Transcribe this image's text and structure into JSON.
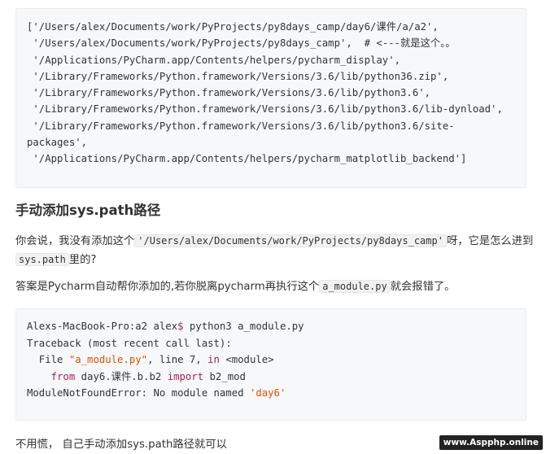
{
  "code_block_1": {
    "lines": [
      "['/Users/alex/Documents/work/PyProjects/py8days_camp/day6/课件/a/a2',",
      " '/Users/alex/Documents/work/PyProjects/py8days_camp',  # <---就是这个。。",
      " '/Applications/PyCharm.app/Contents/helpers/pycharm_display',",
      " '/Library/Frameworks/Python.framework/Versions/3.6/lib/python36.zip',",
      " '/Library/Frameworks/Python.framework/Versions/3.6/lib/python3.6',",
      " '/Library/Frameworks/Python.framework/Versions/3.6/lib/python3.6/lib-dynload',",
      " '/Library/Frameworks/Python.framework/Versions/3.6/lib/python3.6/site-",
      "packages',",
      " '/Applications/PyCharm.app/Contents/helpers/pycharm_matplotlib_backend']"
    ]
  },
  "heading": "手动添加sys.path路径",
  "para1": {
    "t1": "你会说，我没有添加这个",
    "code1": "'/Users/alex/Documents/work/PyProjects/py8days_camp'",
    "t2": "呀，它是怎么进到",
    "code2": "sys.path",
    "t3": "里的?"
  },
  "para2": {
    "t1": "答案是Pycharm自动帮你添加的,若你脱离pycharm再执行这个",
    "code1": "a_module.py",
    "t2": "就会报错了。"
  },
  "code_block_2": {
    "line1_a": "Alexs-MacBook-Pro:a2 alex",
    "line1_dollar": "$",
    "line1_b": " python3 a_module.py",
    "line2": "Traceback (most recent call last):",
    "line3_a": "  File ",
    "line3_str": "\"a_module.py\"",
    "line3_b": ", line 7, ",
    "line3_in": "in",
    "line3_c": " <module>",
    "line4_indent": "    ",
    "line4_from": "from",
    "line4_b": " day6.课件.b.b2 ",
    "line4_import": "import",
    "line4_c": " b2_mod",
    "line5_a": "ModuleNotFoundError: No module named ",
    "line5_str": "'day6'"
  },
  "para3": "不用慌， 自己手动添加sys.path路径就可以",
  "watermark": "www.Aspphp.online",
  "colors": {
    "code_bg": "#f6f8fa",
    "keyword": "#a71d5d",
    "string_red": "#df5000"
  }
}
